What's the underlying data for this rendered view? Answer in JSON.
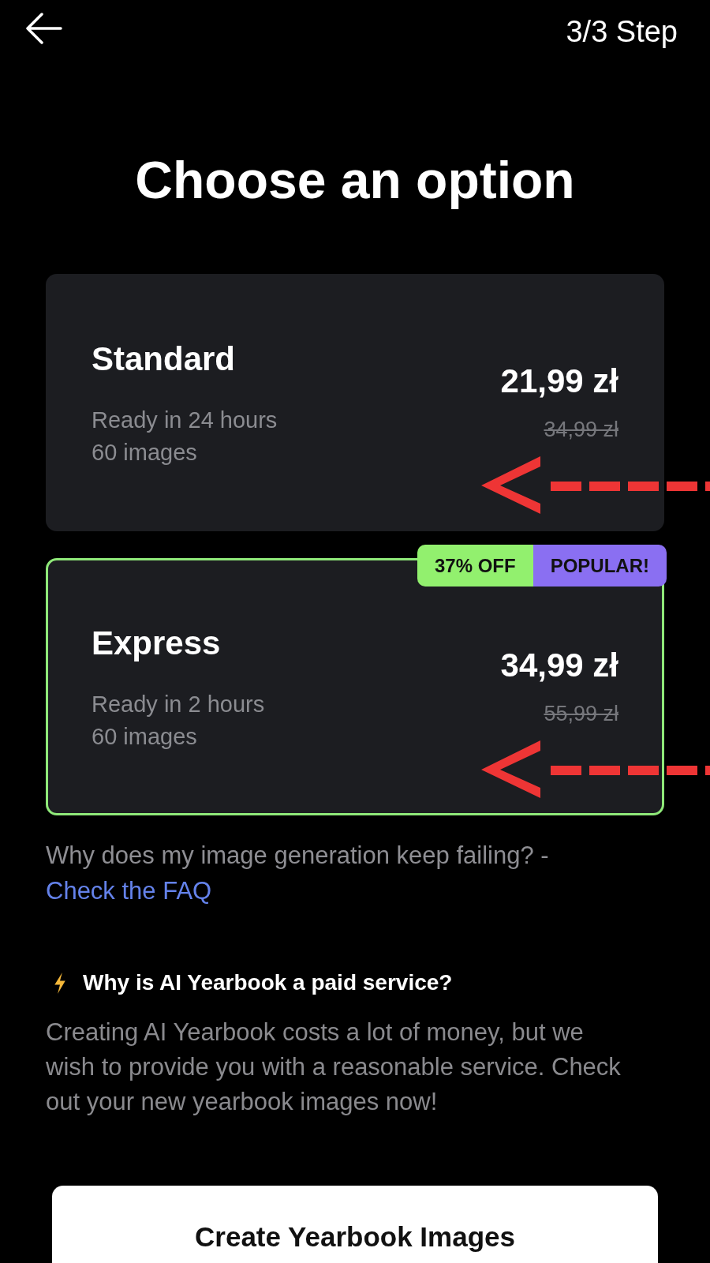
{
  "header": {
    "step": "3/3 Step"
  },
  "title": "Choose an option",
  "plans": [
    {
      "name": "Standard",
      "details": [
        "Ready in 24 hours",
        "60 images"
      ],
      "price": "21,99 zł",
      "original_price": "34,99 zł",
      "selected": false
    },
    {
      "name": "Express",
      "details": [
        "Ready in 2 hours",
        "60 images"
      ],
      "price": "34,99 zł",
      "original_price": "55,99 zł",
      "selected": true,
      "badges": [
        {
          "label": "37% OFF",
          "color": "#92f06e"
        },
        {
          "label": "POPULAR!",
          "color": "#8a6ff2"
        }
      ]
    }
  ],
  "faq": {
    "text": "Why does my image generation keep failing? -",
    "link": "Check the FAQ"
  },
  "info": {
    "heading": "Why is AI Yearbook a paid service?",
    "body": "Creating AI Yearbook costs a lot of money, but we wish to provide you with a reasonable service. Check out your new yearbook images now!"
  },
  "primary_button": {
    "label": "Create Yearbook Images"
  }
}
